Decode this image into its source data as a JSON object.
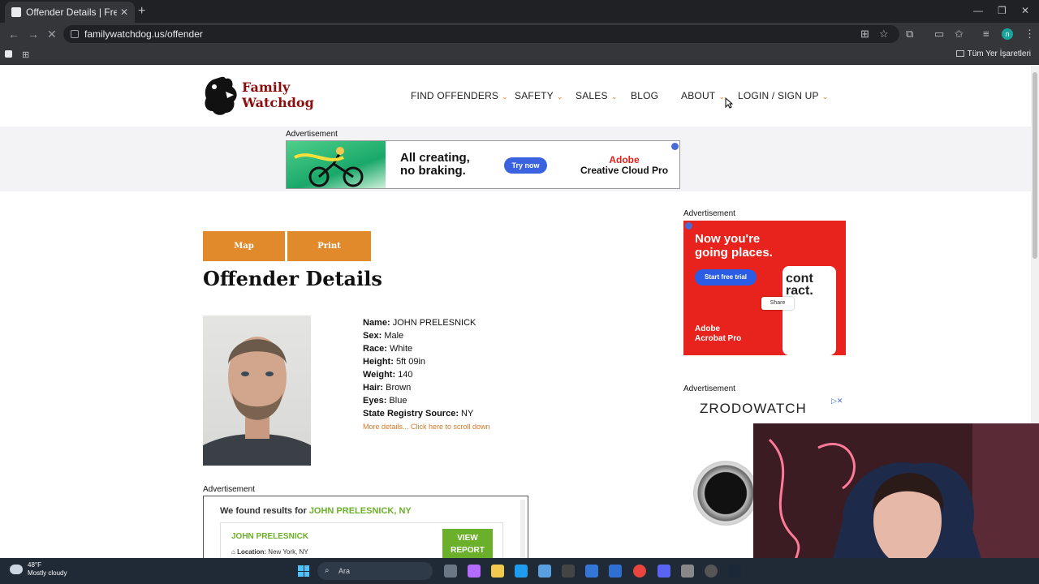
{
  "browser": {
    "tab_title": "Offender Details | Free Offende",
    "tab_close": "✕",
    "new_tab": "+",
    "url": "familywatchdog.us/offender",
    "bookmarks_folder": "Tüm Yer İşaretleri",
    "profile_initial": "n"
  },
  "site": {
    "logo_line1": "Family",
    "logo_line2": "Watchdog",
    "nav": [
      {
        "label": "FIND OFFENDERS",
        "chevron": true
      },
      {
        "label": "SAFETY",
        "chevron": true
      },
      {
        "label": "SALES",
        "chevron": true
      },
      {
        "label": "BLOG",
        "chevron": false
      },
      {
        "label": "ABOUT",
        "chevron": true
      },
      {
        "label": "LOGIN / SIGN UP",
        "chevron": true
      }
    ]
  },
  "ads": {
    "label": "Advertisement",
    "top": {
      "headline1": "All creating,",
      "headline2": "no braking.",
      "cta": "Try now",
      "brand1": "Adobe",
      "brand2": "Creative Cloud Pro"
    },
    "side1": {
      "headline1": "Now you're",
      "headline2": "going places.",
      "cta": "Start free trial",
      "card1": "cont",
      "card2": "ract.",
      "share": "Share",
      "brand1": "Adobe",
      "brand2": "Acrobat Pro"
    },
    "side2": {
      "brand": "ZRODOWATCH"
    },
    "bottom": {
      "found_prefix": "We found results for ",
      "found_name": "JOHN PRELESNICK, NY",
      "result_name": "JOHN PRELESNICK",
      "location_label": "Location:",
      "location": "New York, NY",
      "cta1": "VIEW",
      "cta2": "REPORT"
    }
  },
  "page": {
    "map_button": "Map",
    "print_button": "Print",
    "title": "Offender Details",
    "details": [
      {
        "label": "Name:",
        "value": "JOHN PRELESNICK"
      },
      {
        "label": "Sex:",
        "value": "Male"
      },
      {
        "label": "Race:",
        "value": "White"
      },
      {
        "label": "Height:",
        "value": "5ft 09in"
      },
      {
        "label": "Weight:",
        "value": "140"
      },
      {
        "label": "Hair:",
        "value": "Brown"
      },
      {
        "label": "Eyes:",
        "value": "Blue"
      },
      {
        "label": "State Registry Source:",
        "value": "NY"
      }
    ],
    "more_details": "More details... Click here to scroll down"
  },
  "taskbar": {
    "temp": "48°F",
    "condition": "Mostly cloudy",
    "search_placeholder": "Ara"
  }
}
